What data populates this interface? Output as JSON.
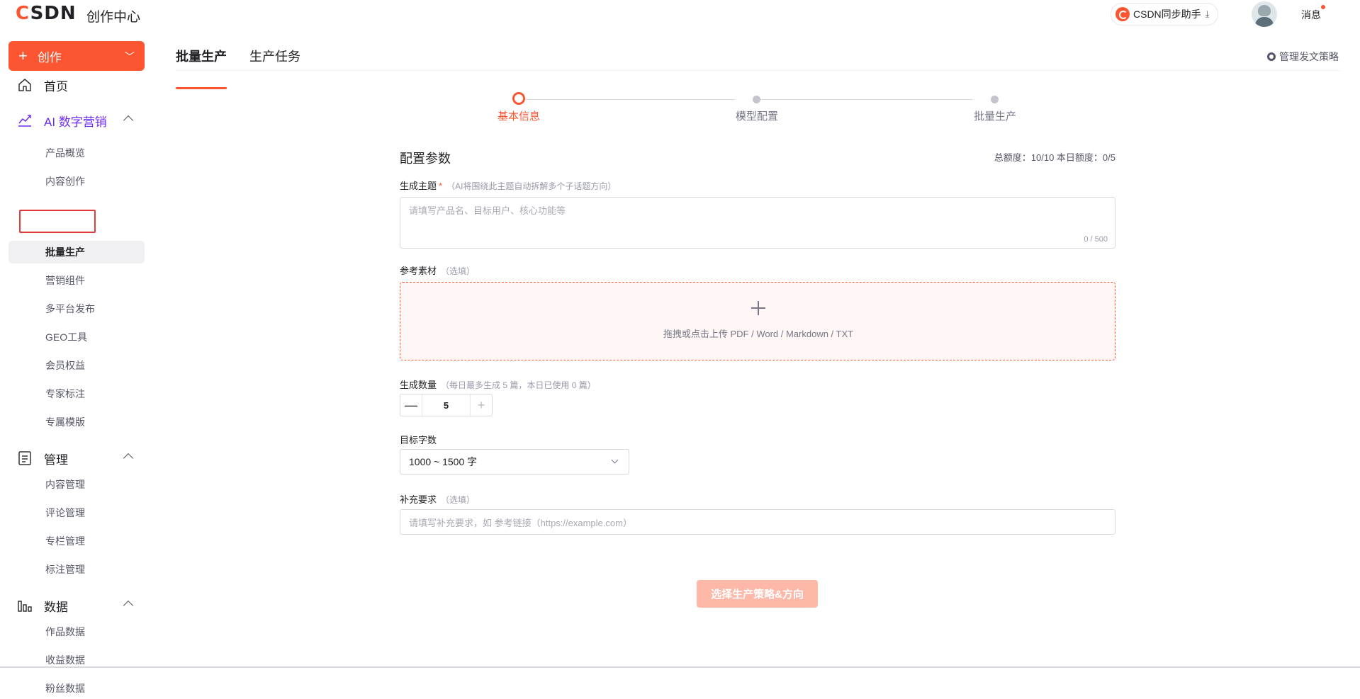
{
  "header": {
    "logo": "CSDN",
    "subtitle": "创作中心",
    "sync_button": "CSDN同步助手",
    "messages": "消息"
  },
  "sidebar": {
    "create_label": "创作",
    "home": "首页",
    "groups": [
      {
        "label": "AI 数字营销",
        "icon": "trend-chart-icon",
        "items": [
          "产品概览",
          "内容创作",
          "批量生产",
          "营销组件",
          "多平台发布",
          "GEO工具",
          "会员权益",
          "专家标注",
          "专属模版"
        ]
      },
      {
        "label": "管理",
        "icon": "document-icon",
        "items": [
          "内容管理",
          "评论管理",
          "专栏管理",
          "标注管理"
        ]
      },
      {
        "label": "数据",
        "icon": "bar-chart-icon",
        "items": [
          "作品数据",
          "收益数据",
          "粉丝数据"
        ]
      }
    ],
    "selected_item": "批量生产"
  },
  "tabs": [
    {
      "label": "批量生产",
      "active": true
    },
    {
      "label": "生产任务",
      "active": false
    }
  ],
  "manage_strategy": "管理发文策略",
  "steps": [
    {
      "label": "基本信息",
      "active": true
    },
    {
      "label": "模型配置",
      "active": false
    },
    {
      "label": "批量生产",
      "active": false
    }
  ],
  "form": {
    "title": "配置参数",
    "quota": "总额度：10/10 本日额度：0/5",
    "topic": {
      "label": "生成主题",
      "required": "*",
      "hint": "（AI将围绕此主题自动拆解多个子话题方向）",
      "placeholder": "请填写产品名、目标用户、核心功能等",
      "counter": "0 / 500"
    },
    "material": {
      "label": "参考素材",
      "hint": "（选填）",
      "upload_text": "拖拽或点击上传 PDF / Word / Markdown / TXT"
    },
    "count": {
      "label": "生成数量",
      "hint": "（每日最多生成 5 篇，本日已使用 0 篇）",
      "value": "5"
    },
    "word_count": {
      "label": "目标字数",
      "value": "1000 ~ 1500 字"
    },
    "extra": {
      "label": "补充要求",
      "hint": "（选填）",
      "placeholder": "请填写补充要求，如 参考链接（https://example.com）"
    },
    "submit": "选择生产策略&方向"
  },
  "colors": {
    "accent": "#fc5531",
    "active_group": "#6e2cf2",
    "highlight": "#e33a3a"
  }
}
